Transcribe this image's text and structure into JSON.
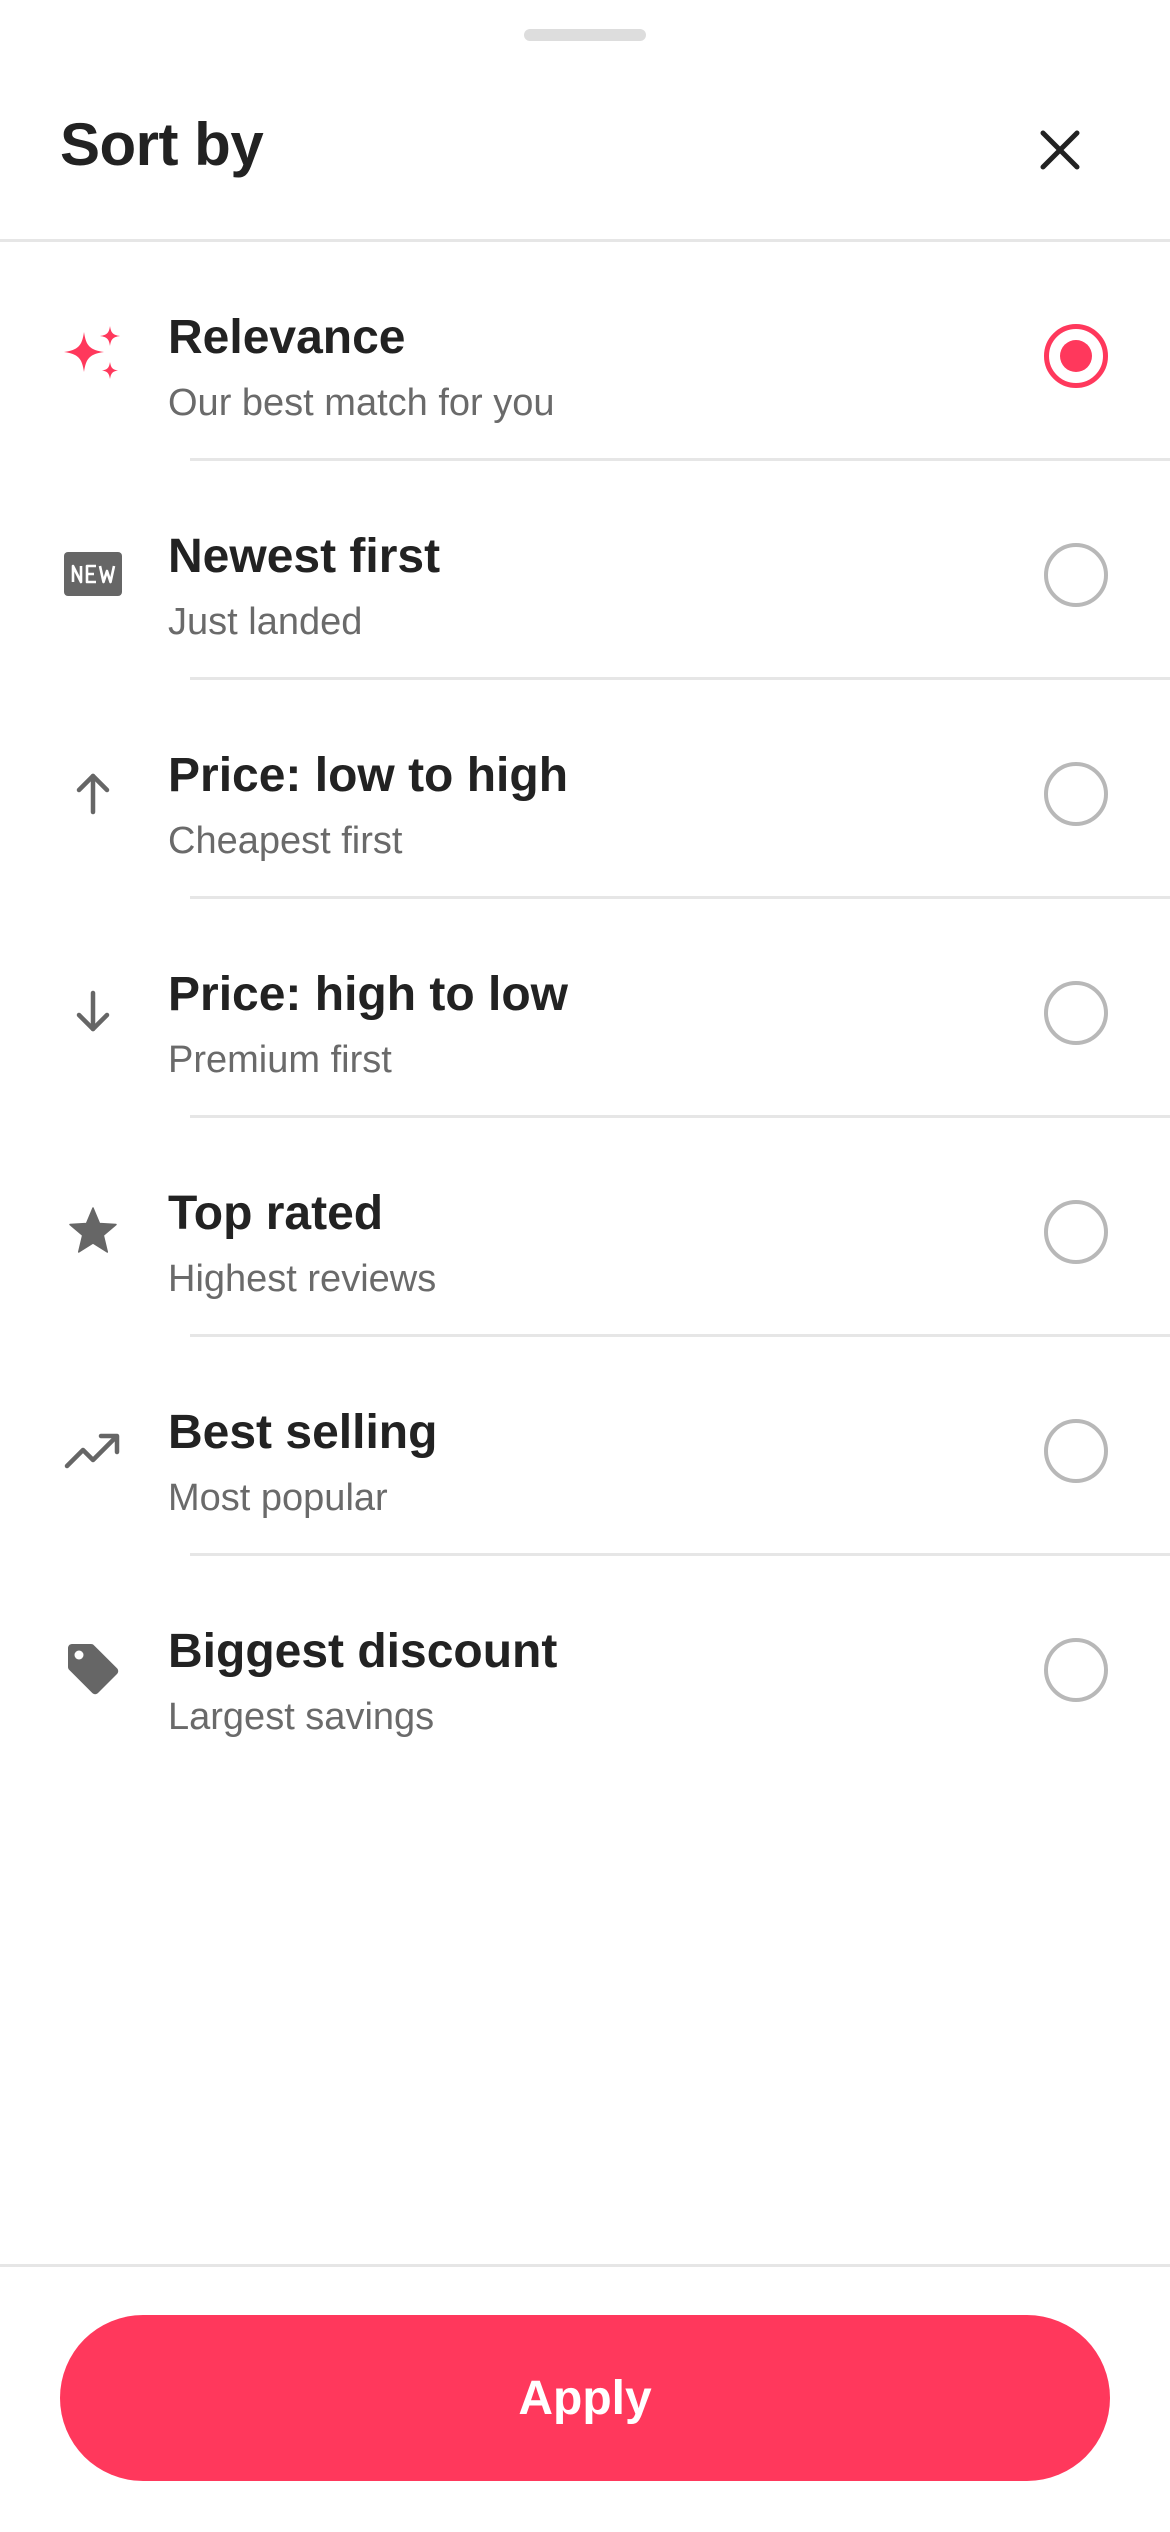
{
  "sheet": {
    "title": "Sort by",
    "close_icon": "close-icon",
    "apply_label": "Apply"
  },
  "colors": {
    "accent": "#ff385c",
    "text_primary": "#222222",
    "text_secondary": "#6a6a6a",
    "icon_gray": "#666666",
    "radio_border": "#b8b8b8",
    "divider": "#e6e6e6"
  },
  "options": [
    {
      "label": "Relevance",
      "sublabel": "Our best match for you",
      "icon": "sparkles-icon",
      "selected": true
    },
    {
      "label": "Newest first",
      "sublabel": "Just landed",
      "icon": "new-badge-icon",
      "selected": false
    },
    {
      "label": "Price: low to high",
      "sublabel": "Cheapest first",
      "icon": "arrow-up-icon",
      "selected": false
    },
    {
      "label": "Price: high to low",
      "sublabel": "Premium first",
      "icon": "arrow-down-icon",
      "selected": false
    },
    {
      "label": "Top rated",
      "sublabel": "Highest reviews",
      "icon": "star-icon",
      "selected": false
    },
    {
      "label": "Best selling",
      "sublabel": "Most popular",
      "icon": "trending-up-icon",
      "selected": false
    },
    {
      "label": "Biggest discount",
      "sublabel": "Largest savings",
      "icon": "tag-icon",
      "selected": false
    }
  ]
}
